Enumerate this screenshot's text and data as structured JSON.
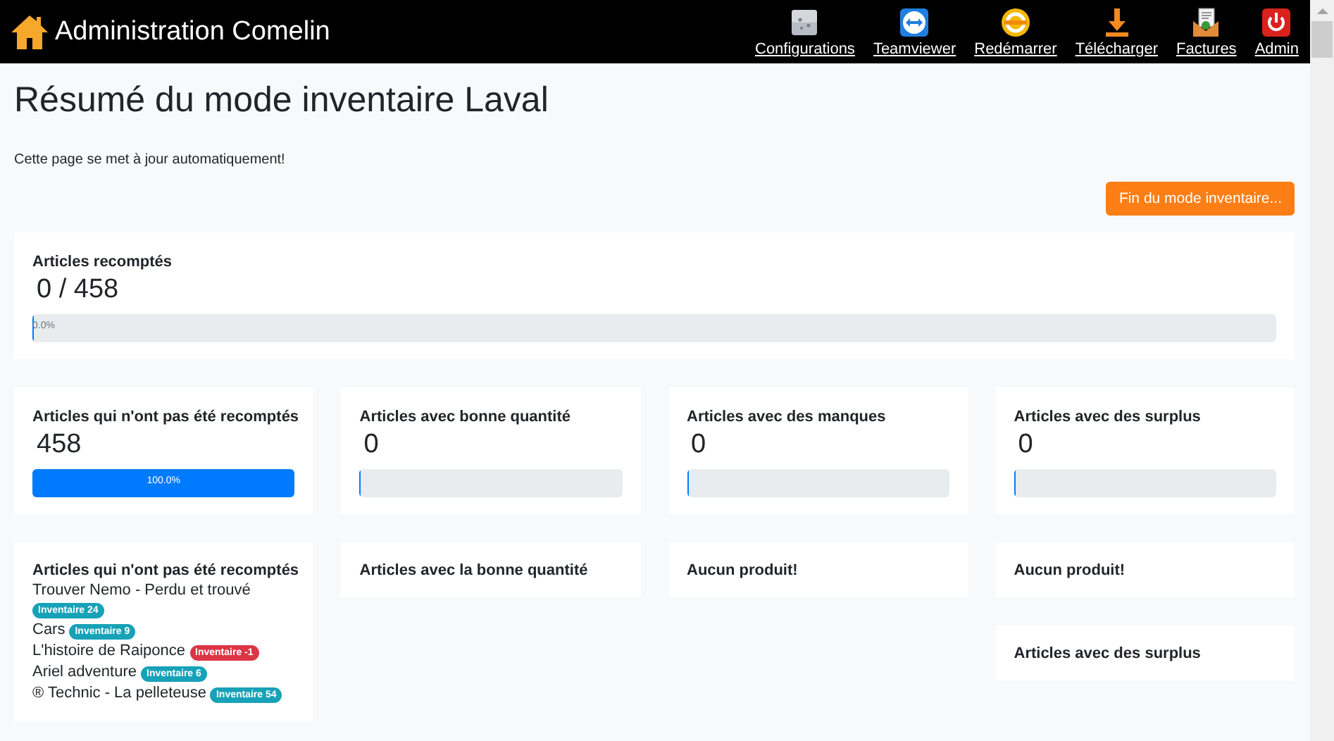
{
  "header": {
    "title": "Administration Comelin",
    "nav": [
      {
        "label": "Configurations"
      },
      {
        "label": "Teamviewer"
      },
      {
        "label": "Redémarrer"
      },
      {
        "label": "Télécharger"
      },
      {
        "label": "Factures"
      },
      {
        "label": "Admin"
      }
    ]
  },
  "page": {
    "title": "Résumé du mode inventaire Laval",
    "notice": "Cette page se met à jour automatiquement!",
    "end_button": "Fin du mode inventaire..."
  },
  "summary": {
    "title": "Articles recomptés",
    "counter": "0 / 458",
    "progress": {
      "level": 0,
      "label": "0.0%"
    }
  },
  "stats": [
    {
      "title": "Articles qui n'ont pas été recomptés",
      "value": "458",
      "progress": {
        "level": 1,
        "label": "100.0%"
      }
    },
    {
      "title": "Articles avec bonne quantité",
      "value": "0",
      "progress": {
        "level": 0
      }
    },
    {
      "title": "Articles avec des manques",
      "value": "0",
      "progress": {
        "level": 0
      }
    },
    {
      "title": "Articles avec des surplus",
      "value": "0",
      "progress": {
        "level": 0
      }
    }
  ],
  "columns": [
    {
      "cards": [
        {
          "title": "Articles qui n'ont pas été recomptés",
          "items": [
            {
              "name": "Trouver Nemo - Perdu et trouvé",
              "badge": "Inventaire 24",
              "color": "#17a2b8"
            },
            {
              "name": "Cars",
              "badge": "Inventaire 9",
              "color": "#17a2b8"
            },
            {
              "name": "L'histoire de Raiponce",
              "badge": "Inventaire -1",
              "color": "#dc3545"
            },
            {
              "name": "Ariel adventure",
              "badge": "Inventaire 6",
              "color": "#17a2b8"
            },
            {
              "name": "® Technic - La pelleteuse",
              "badge": "Inventaire 54",
              "color": "#17a2b8"
            }
          ]
        }
      ]
    },
    {
      "cards": [
        {
          "title": "Articles avec la bonne quantité"
        }
      ]
    },
    {
      "cards": [
        {
          "title": "Aucun produit!"
        }
      ]
    },
    {
      "cards": [
        {
          "title": "Aucun produit!"
        },
        {
          "title": "Articles avec des surplus"
        }
      ]
    }
  ]
}
